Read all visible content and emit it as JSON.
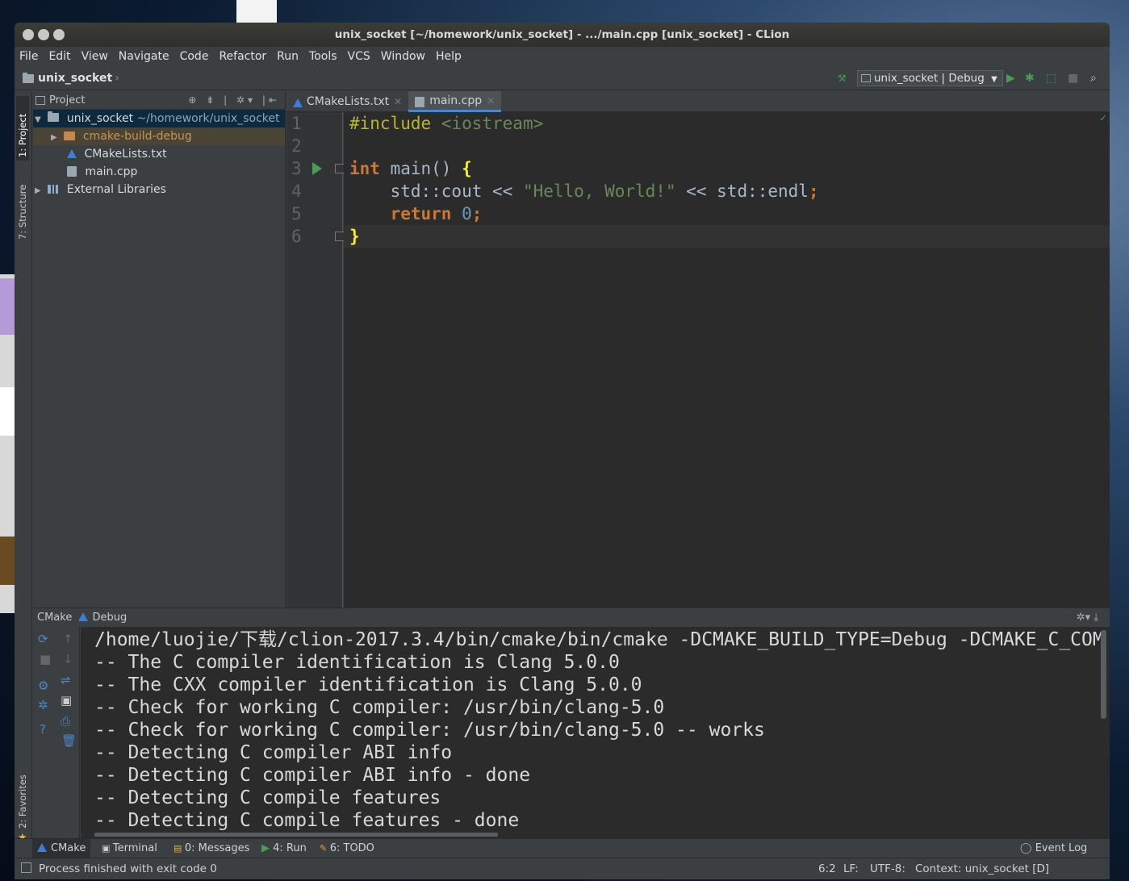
{
  "window": {
    "title": "unix_socket [~/homework/unix_socket] - .../main.cpp [unix_socket] - CLion"
  },
  "menu": [
    "File",
    "Edit",
    "View",
    "Navigate",
    "Code",
    "Refactor",
    "Run",
    "Tools",
    "VCS",
    "Window",
    "Help"
  ],
  "navbar": {
    "breadcrumb": "unix_socket",
    "run_config": "unix_socket | Debug"
  },
  "side_tabs": {
    "project": "1: Project",
    "structure": "7: Structure",
    "favorites": "2: Favorites"
  },
  "project_panel": {
    "title": "Project",
    "root_name": "unix_socket",
    "root_path": "~/homework/unix_socket",
    "items": [
      "cmake-build-debug",
      "CMakeLists.txt",
      "main.cpp",
      "External Libraries"
    ]
  },
  "editor": {
    "tabs": [
      "CMakeLists.txt",
      "main.cpp"
    ],
    "active_tab": "main.cpp",
    "line_numbers": [
      "1",
      "2",
      "3",
      "4",
      "5",
      "6"
    ],
    "code": {
      "l1_directive": "#include",
      "l1_header": " <iostream>",
      "l3_kw": "int",
      "l3_rest": " main() ",
      "l3_brace": "{",
      "l4_a": "    std::cout << ",
      "l4_str": "\"Hello, World!\"",
      "l4_b": " << std::endl",
      "l4_semi": ";",
      "l5_kw": "    return",
      "l5_num": " 0",
      "l5_semi": ";",
      "l6_brace": "}"
    }
  },
  "cmake_panel": {
    "title": "CMake",
    "config": "Debug",
    "output": [
      "/home/luojie/下载/clion-2017.3.4/bin/cmake/bin/cmake -DCMAKE_BUILD_TYPE=Debug -DCMAKE_C_COM",
      "-- The C compiler identification is Clang 5.0.0",
      "-- The CXX compiler identification is Clang 5.0.0",
      "-- Check for working C compiler: /usr/bin/clang-5.0",
      "-- Check for working C compiler: /usr/bin/clang-5.0 -- works",
      "-- Detecting C compiler ABI info",
      "-- Detecting C compiler ABI info - done",
      "-- Detecting C compile features",
      "-- Detecting C compile features - done"
    ]
  },
  "bottom_tabs": {
    "cmake": "CMake",
    "terminal": "Terminal",
    "messages": "0: Messages",
    "run": "4: Run",
    "todo": "6: TODO",
    "event_log": "Event Log"
  },
  "status_bar": {
    "message": "Process finished with exit code 0",
    "position": "6:2",
    "line_sep": "LF:",
    "encoding": "UTF-8:",
    "context": "Context: unix_socket [D]"
  },
  "colors": {
    "keyword": "#cc7832",
    "string": "#6a8759",
    "number": "#6897bb",
    "directive": "#bbb529",
    "brace": "#ffef28",
    "run_green": "#499c54",
    "selection": "#0d293e"
  }
}
